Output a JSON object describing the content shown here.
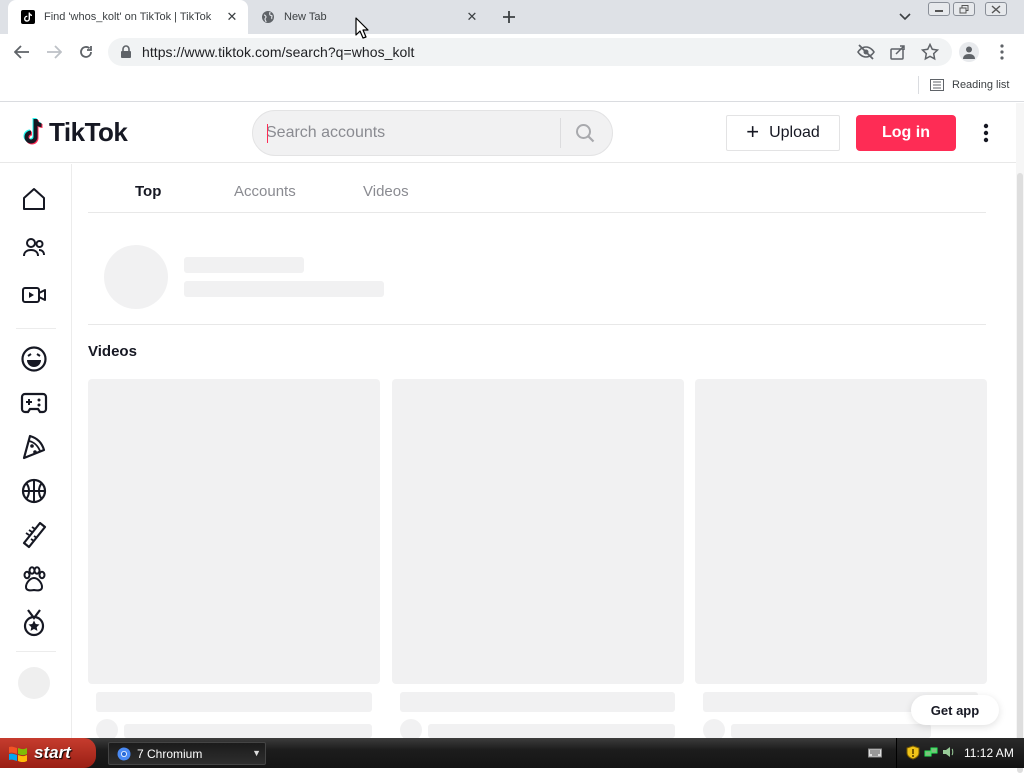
{
  "browser": {
    "tabs": [
      {
        "title": "Find 'whos_kolt' on TikTok | TikTok",
        "active": true,
        "icon": "tiktok-icon"
      },
      {
        "title": "New Tab",
        "active": false,
        "icon": "globe-icon"
      }
    ],
    "url": "https://www.tiktok.com/search?q=whos_kolt",
    "reading_list": "Reading list"
  },
  "tiktok": {
    "logo_text": "TikTok",
    "search_placeholder": "Search accounts",
    "upload_label": "Upload",
    "login_label": "Log in",
    "brand_color": "#fe2c55",
    "sidebar_icons": [
      "home-icon",
      "following-icon",
      "live-icon",
      "comedy-icon",
      "gaming-icon",
      "food-icon",
      "sports-icon",
      "beauty-icon",
      "animals-icon",
      "achievement-icon"
    ],
    "tabs": [
      {
        "label": "Top",
        "active": true
      },
      {
        "label": "Accounts",
        "active": false
      },
      {
        "label": "Videos",
        "active": false
      }
    ],
    "videos_heading": "Videos",
    "get_app": "Get app"
  },
  "taskbar": {
    "start_label": "start",
    "task_label": "7 Chromium",
    "clock": "11:12 AM"
  }
}
